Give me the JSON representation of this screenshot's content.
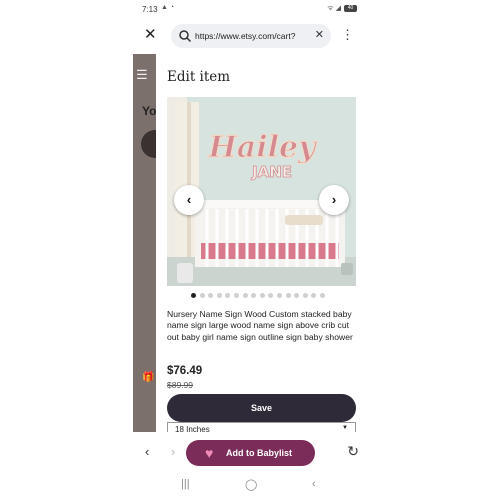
{
  "status_bar": {
    "time": "7:13",
    "left_icons": "▲ ◔",
    "right_icons": "ᯤ ◢",
    "battery": "40"
  },
  "browser": {
    "close_icon": "close-icon",
    "url": "https://www.etsy.com/cart?",
    "clear_icon": "close-icon",
    "menu_icon": "more-vert-icon"
  },
  "background_page": {
    "menu_icon": "☰",
    "heading_fragment": "Yo",
    "gift_icon": "🎁"
  },
  "edit_item": {
    "title": "Edit item",
    "image_alt_text": "Hailey JANE",
    "image_name_top": "Hailey",
    "image_name_bottom": "JANE",
    "carousel_total": 16,
    "carousel_active": 1,
    "description": "Nursery Name Sign Wood Custom stacked baby name sign large wood name sign above crib cut out baby girl name sign outline sign baby shower",
    "price": "$76.49",
    "original_price": "$89.99",
    "save_label": "Save",
    "size_option": "18 Inches"
  },
  "toolbar": {
    "add_to_babylist_label": "Add to Babylist"
  },
  "colors": {
    "save_button": "#2f2a38",
    "babylist_button": "#7b2c58",
    "overlay_background": "#7b706c"
  }
}
